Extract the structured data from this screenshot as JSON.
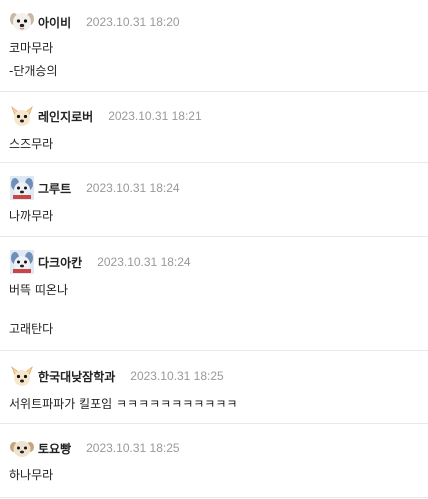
{
  "comments": [
    {
      "avatar": "white-puppy-avatar",
      "nickname": "아이비",
      "datetime": "2023.10.31  18:20",
      "lines": [
        "코마무라",
        "-단개승의"
      ]
    },
    {
      "avatar": "chihuahua-avatar",
      "nickname": "레인지로버",
      "datetime": "2023.10.31  18:21",
      "lines": [
        "스즈무라"
      ]
    },
    {
      "avatar": "blue-dog-avatar",
      "nickname": "그루트",
      "datetime": "2023.10.31  18:24",
      "lines": [
        "나까무라"
      ]
    },
    {
      "avatar": "blue-dog-avatar",
      "nickname": "다크아칸",
      "datetime": "2023.10.31  18:24",
      "lines": [
        "버뜩 띠온나",
        "",
        "고래탄다"
      ]
    },
    {
      "avatar": "chihuahua-avatar",
      "nickname": "한국대낮잠학과",
      "datetime": "2023.10.31  18:25",
      "lines": [
        "서위트파파가 킬포임 ㅋㅋㅋㅋㅋㅋㅋㅋㅋㅋㅋ"
      ]
    },
    {
      "avatar": "beige-puppy-avatar",
      "nickname": "토요빵",
      "datetime": "2023.10.31  18:25",
      "lines": [
        "하나무라"
      ]
    }
  ],
  "colors": {
    "nickname": "#222222",
    "datetime": "#999999",
    "text": "#222222",
    "divider": "#e9e9e9"
  }
}
